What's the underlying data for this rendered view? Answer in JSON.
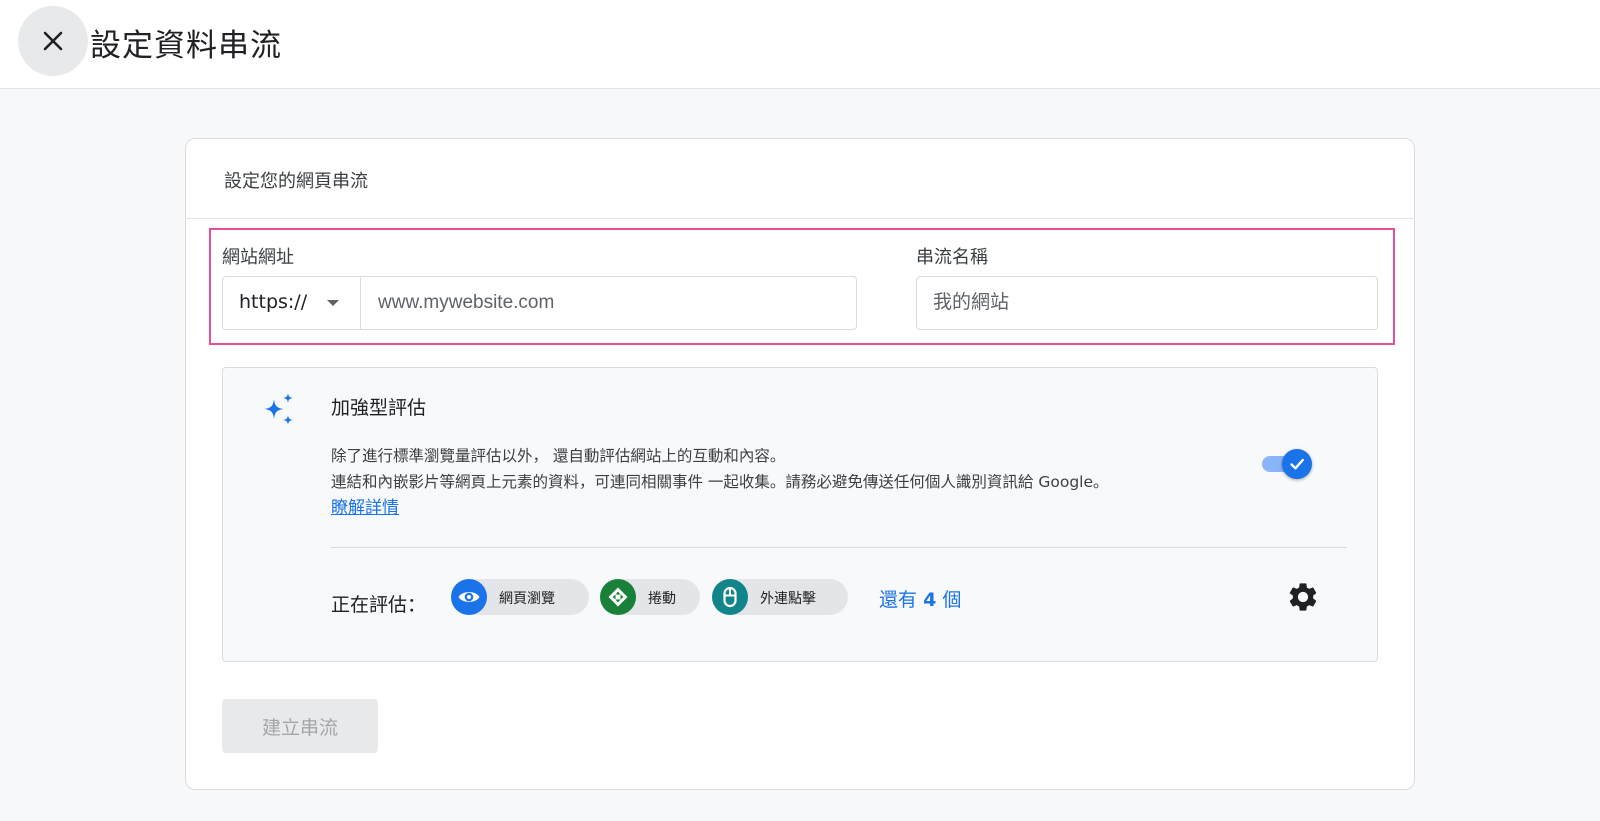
{
  "header": {
    "title": "設定資料串流",
    "close_icon": "close-icon"
  },
  "card": {
    "title": "設定您的網頁串流",
    "url_field": {
      "label": "網站網址",
      "protocol": "https://",
      "placeholder": "www.mywebsite.com",
      "value": ""
    },
    "stream_name_field": {
      "label": "串流名稱",
      "placeholder": "我的網站",
      "value": ""
    },
    "enhanced_measurement": {
      "icon": "sparkle-icon",
      "title": "加強型評估",
      "description_line1": "除了進行標準瀏覽量評估以外， 還自動評估網站上的互動和內容。",
      "description_line2": "連結和內嵌影片等網頁上元素的資料，可連同相關事件 一起收集。請務必避免傳送任何個人識別資訊給 Google。",
      "learn_more": "瞭解詳情",
      "enabled": true,
      "measuring_label": "正在評估：",
      "chips": [
        {
          "label": "網頁瀏覽",
          "icon": "eye-icon",
          "color": "#1a73e8"
        },
        {
          "label": "捲動",
          "icon": "scroll-icon",
          "color": "#188038"
        },
        {
          "label": "外連點擊",
          "icon": "mouse-icon",
          "color": "#12858a"
        }
      ],
      "more_prefix": "還有",
      "more_count": "4",
      "more_suffix": "個",
      "settings_icon": "gear-icon"
    },
    "create_button": "建立串流"
  },
  "colors": {
    "accent": "#1a73e8",
    "highlight_border": "#e64e96",
    "disabled_button_bg": "#e8e9ea"
  }
}
